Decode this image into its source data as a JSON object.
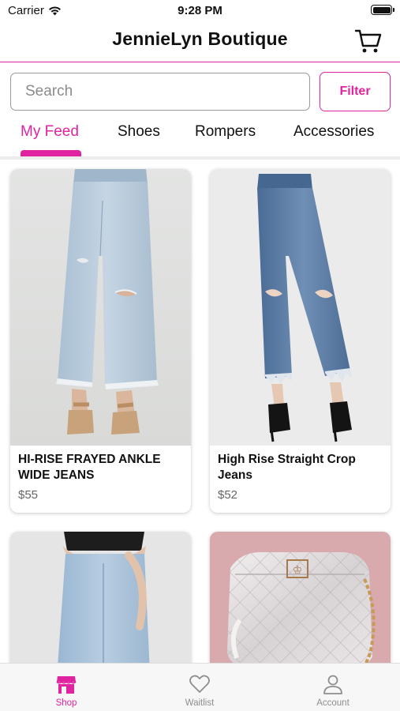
{
  "status_bar": {
    "carrier": "Carrier",
    "time": "9:28 PM"
  },
  "header": {
    "title": "JennieLyn Boutique",
    "cart_icon": "cart-icon"
  },
  "search": {
    "placeholder": "Search",
    "value": "",
    "filter_label": "Filter"
  },
  "tabs": [
    {
      "label": "My Feed",
      "active": true
    },
    {
      "label": "Shoes",
      "active": false
    },
    {
      "label": "Rompers",
      "active": false
    },
    {
      "label": "Accessories",
      "active": false
    }
  ],
  "products": [
    {
      "name": "HI-RISE FRAYED ANKLE WIDE JEANS",
      "price": "$55"
    },
    {
      "name": "High Rise Straight Crop Jeans",
      "price": "$52"
    },
    {
      "name": "",
      "price": ""
    },
    {
      "name": "",
      "price": ""
    }
  ],
  "tabbar": [
    {
      "label": "Shop",
      "icon": "store-icon",
      "active": true
    },
    {
      "label": "Waitlist",
      "icon": "heart-icon",
      "active": false
    },
    {
      "label": "Account",
      "icon": "person-icon",
      "active": false
    }
  ],
  "colors": {
    "accent": "#e0239f",
    "text": "#111111",
    "muted": "#8e8e8e"
  }
}
